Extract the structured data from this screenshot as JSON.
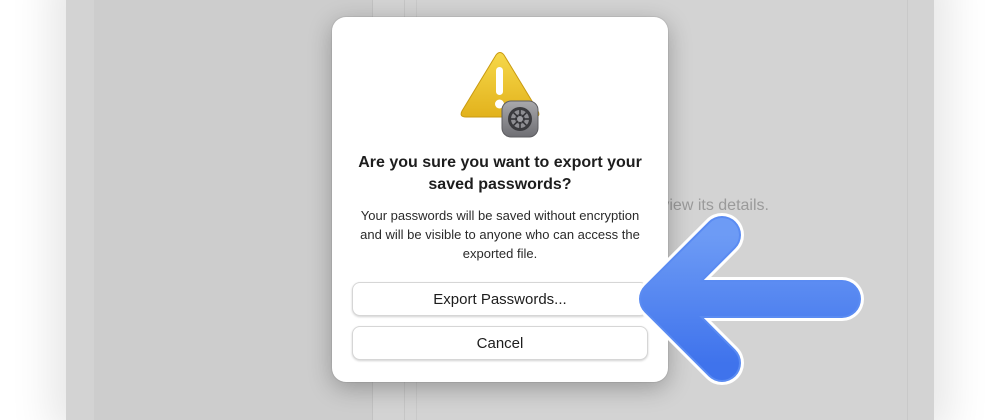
{
  "background": {
    "hint_text": "count to view its details."
  },
  "dialog": {
    "icon": "warning-with-settings-badge-icon",
    "title": "Are you sure you want to export your saved passwords?",
    "message": "Your passwords will be saved without encryption and will be visible to anyone who can access the exported file.",
    "primary_button": "Export Passwords...",
    "cancel_button": "Cancel"
  },
  "annotation": {
    "arrow_icon": "pointer-arrow-icon",
    "color": "#4a80f0"
  }
}
